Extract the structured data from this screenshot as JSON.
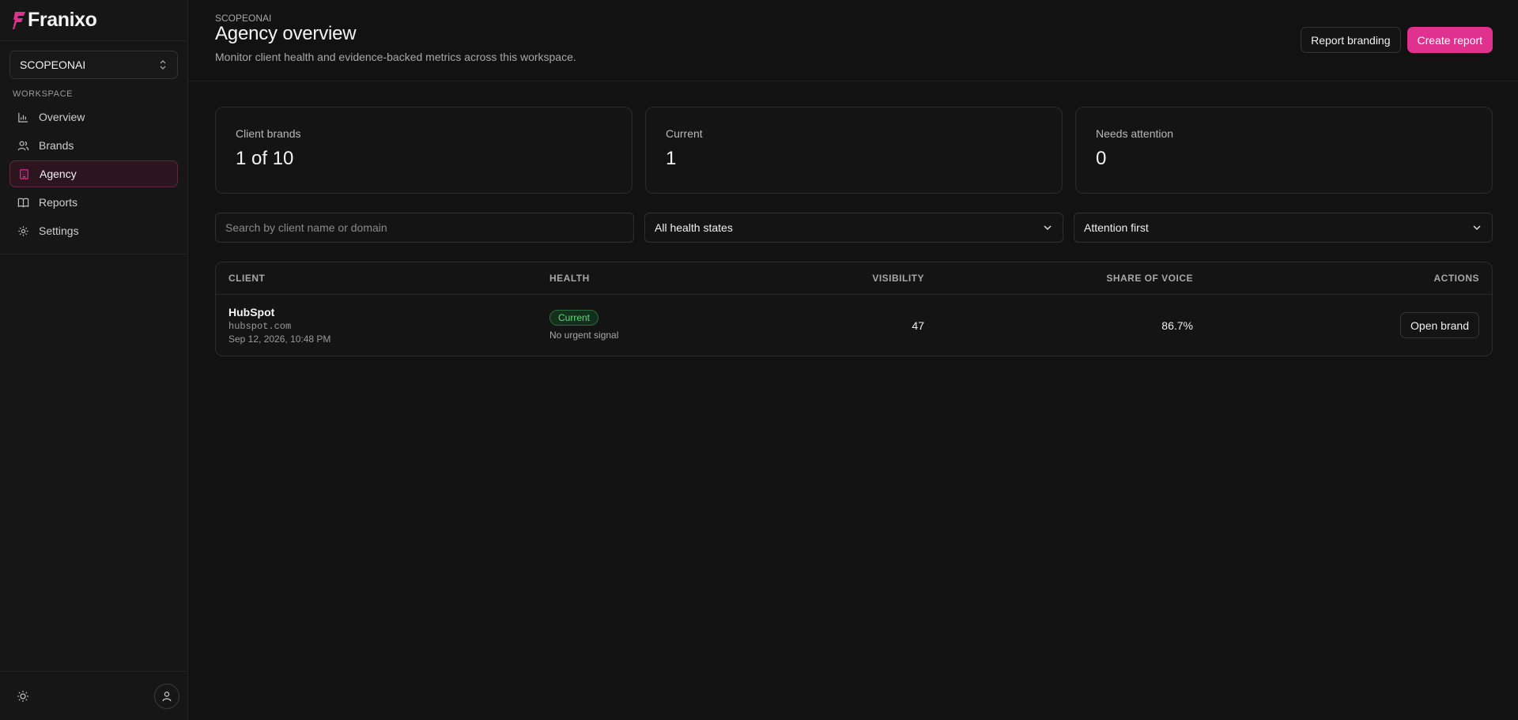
{
  "app": {
    "name": "Franixo",
    "brand_color": "#e0318f"
  },
  "sidebar": {
    "workspace_select": "SCOPEONAI",
    "section_label": "WORKSPACE",
    "items": [
      {
        "label": "Overview",
        "icon": "bar-chart-icon"
      },
      {
        "label": "Brands",
        "icon": "users-icon"
      },
      {
        "label": "Agency",
        "icon": "building-icon",
        "active": true
      },
      {
        "label": "Reports",
        "icon": "book-icon"
      },
      {
        "label": "Settings",
        "icon": "gear-icon"
      }
    ]
  },
  "header": {
    "breadcrumb": "SCOPEONAI",
    "title": "Agency overview",
    "subtitle": "Monitor client health and evidence-backed metrics across this workspace.",
    "report_branding_label": "Report branding",
    "create_report_label": "Create report"
  },
  "stats": [
    {
      "label": "Client brands",
      "value": "1 of 10"
    },
    {
      "label": "Current",
      "value": "1"
    },
    {
      "label": "Needs attention",
      "value": "0"
    }
  ],
  "filters": {
    "search_placeholder": "Search by client name or domain",
    "health_select": "All health states",
    "sort_select": "Attention first"
  },
  "table": {
    "columns": [
      "CLIENT",
      "HEALTH",
      "VISIBILITY",
      "SHARE OF VOICE",
      "ACTIONS"
    ],
    "rows": [
      {
        "name": "HubSpot",
        "domain": "hubspot.com",
        "date": "Sep 12, 2026, 10:48 PM",
        "health_badge": "Current",
        "health_note": "No urgent signal",
        "visibility": "47",
        "share_of_voice": "86.7%",
        "action_label": "Open brand"
      }
    ]
  }
}
